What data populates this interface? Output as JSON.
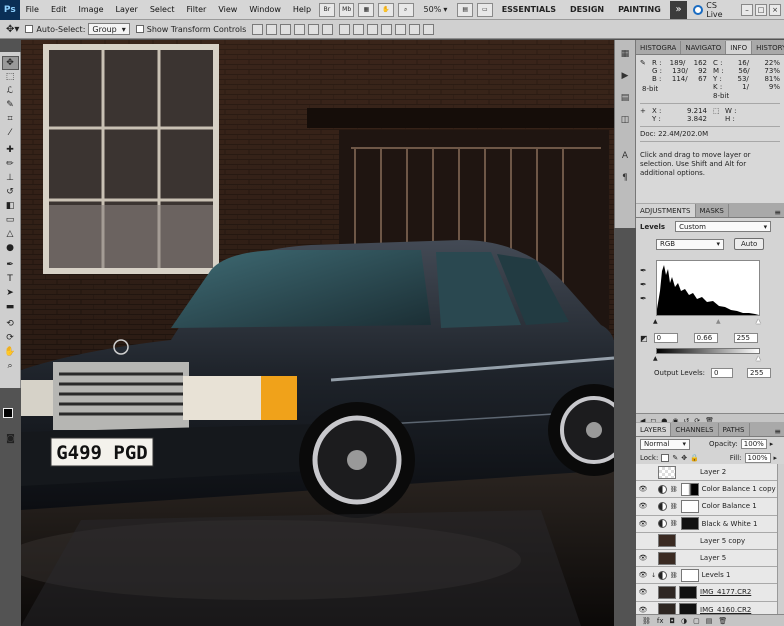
{
  "app": {
    "logo": "Ps",
    "menu": [
      "File",
      "Edit",
      "Image",
      "Layer",
      "Select",
      "Filter",
      "View",
      "Window",
      "Help"
    ],
    "menubar_icons": [
      "Br",
      "Mb"
    ],
    "zoom": "50%",
    "workspaces": [
      "ESSENTIALS",
      "DESIGN",
      "PAINTING"
    ],
    "more": "»",
    "cs_live": "CS Live",
    "window_buttons": [
      "–",
      "□",
      "×"
    ]
  },
  "options": {
    "auto_select_label": "Auto-Select:",
    "auto_select_value": "Group",
    "transform_label": "Show Transform Controls"
  },
  "panels": {
    "top_tabs": [
      "HISTOGRA",
      "NAVIGATO",
      "INFO",
      "HISTORY"
    ],
    "info": {
      "left_rgb": [
        [
          "R :",
          "189/",
          "162"
        ],
        [
          "G :",
          "130/",
          "92"
        ],
        [
          "B :",
          "114/",
          "67"
        ]
      ],
      "left_bit": "8-bit",
      "right_cmyk": [
        [
          "C :",
          "16/",
          "22%"
        ],
        [
          "M :",
          "56/",
          "73%"
        ],
        [
          "Y :",
          "53/",
          "81%"
        ],
        [
          "K :",
          "1/",
          "9%"
        ]
      ],
      "right_bit": "8-bit",
      "xy": [
        [
          "X :",
          "9.214"
        ],
        [
          "Y :",
          "3.842"
        ]
      ],
      "wh": [
        [
          "W :",
          ""
        ],
        [
          "H :",
          ""
        ]
      ],
      "doc": "Doc: 22.4M/202.0M",
      "hint": "Click and drag to move layer or selection.  Use Shift and Alt for additional options."
    },
    "adjust_tabs": [
      "ADJUSTMENTS",
      "MASKS"
    ],
    "levels": {
      "label": "Levels",
      "preset": "Custom",
      "channel": "RGB",
      "auto": "Auto",
      "input": [
        "0",
        "0.66",
        "255"
      ],
      "output_label": "Output Levels:",
      "output": [
        "0",
        "255"
      ]
    },
    "layers_tabs": [
      "LAYERS",
      "CHANNELS",
      "PATHS"
    ],
    "layers_ctrl": {
      "blend": "Normal",
      "opacity_label": "Opacity:",
      "opacity": "100%",
      "lock_label": "Lock:",
      "fill_label": "Fill:",
      "fill": "100%"
    },
    "layers": [
      {
        "name": "Layer 2",
        "visible": false,
        "kind": "pixel-transparent"
      },
      {
        "name": "Color Balance 1 copy",
        "visible": true,
        "kind": "adjust"
      },
      {
        "name": "Color Balance 1",
        "visible": true,
        "kind": "adjust"
      },
      {
        "name": "Black & White 1",
        "visible": true,
        "kind": "adjust-mask"
      },
      {
        "name": "Layer 5 copy",
        "visible": false,
        "kind": "pixel"
      },
      {
        "name": "Layer 5",
        "visible": true,
        "kind": "pixel"
      },
      {
        "name": "Levels 1",
        "visible": true,
        "kind": "levels"
      },
      {
        "name": "IMG_4177.CR2",
        "visible": true,
        "kind": "photo"
      },
      {
        "name": "IMG_4160.CR2",
        "visible": true,
        "kind": "photo"
      }
    ],
    "layers_footer": [
      "⛓",
      "fx",
      "◘",
      "◑",
      "▢",
      "▤",
      "🗑"
    ],
    "adjust_footer": [
      "◀",
      "◻",
      "●",
      "◉",
      "↺",
      "⟳",
      "🗑"
    ]
  },
  "canvas": {
    "plate": "G499 PGD"
  },
  "colors": {
    "menubar": "#d6d6d6",
    "panel_bg": "#d4d4d4",
    "canvas_bg": "#1c1410"
  }
}
